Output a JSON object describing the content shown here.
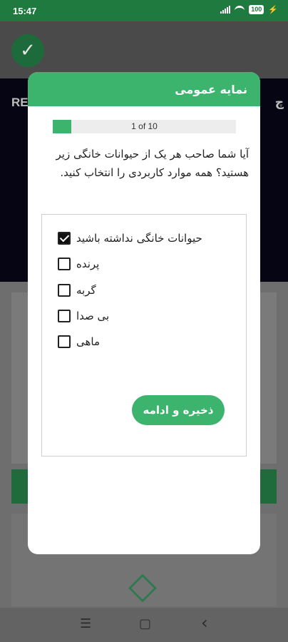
{
  "status_bar": {
    "time": "15:47",
    "battery": "100"
  },
  "background": {
    "hero_left_text": "RE",
    "hero_right_text": "چ"
  },
  "modal": {
    "title": "نمایه عمومی",
    "progress": {
      "label": "1 of 10",
      "current": 1,
      "total": 10
    },
    "question": "آیا شما صاحب هر یک از حیوانات خانگی زیر هستید؟ همه موارد کاربردی را انتخاب کنید.",
    "options": [
      {
        "label": "حیوانات خانگی نداشته باشید",
        "checked": true
      },
      {
        "label": "پرنده",
        "checked": false
      },
      {
        "label": "گربه",
        "checked": false
      },
      {
        "label": "بی صدا",
        "checked": false
      },
      {
        "label": "ماهی",
        "checked": false
      }
    ],
    "save_label": "ذخیره و ادامه"
  },
  "nav": {
    "menu_glyph": "☰",
    "home_glyph": "▢",
    "back_glyph": "‹"
  },
  "colors": {
    "accent": "#3cb46e",
    "status_bar": "#1f7a3f"
  }
}
